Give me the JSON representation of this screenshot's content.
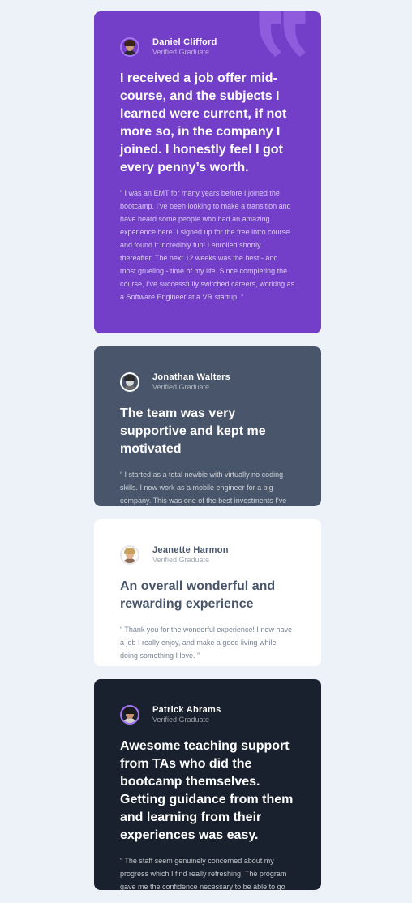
{
  "testimonials": [
    {
      "name": "Daniel Clifford",
      "role": "Verified Graduate",
      "headline": "I received a job offer mid-course, and the subjects I learned were current, if not more so, in the company I joined. I honestly feel I got every penny’s worth.",
      "body": "“ I was an EMT for many years before I joined the bootcamp. I’ve been looking to make a transition and have heard some people who had an amazing experience here. I signed up for the free intro course and found it incredibly fun! I enrolled shortly thereafter. The next 12 weeks was the best - and most grueling - time of my life. Since completing the course, I’ve successfully switched careers, working as a Software Engineer at a VR startup. ”",
      "color": "#733fc8"
    },
    {
      "name": "Jonathan Walters",
      "role": "Verified Graduate",
      "headline": "The team was very supportive and kept me motivated",
      "body": "“ I started as a total newbie with virtually no coding skills. I now work as a mobile engineer for a big company. This was one of the best investments I’ve made in myself. ”",
      "color": "#48556a"
    },
    {
      "name": "Jeanette Harmon",
      "role": "Verified Graduate",
      "headline": "An overall wonderful and rewarding experience",
      "body": "“ Thank you for the wonderful experience! I now have a job I really enjoy, and make a good living while doing something I love. ”",
      "color": "#ffffff"
    },
    {
      "name": "Patrick Abrams",
      "role": "Verified Graduate",
      "headline": "Awesome teaching support from TAs who did the bootcamp themselves. Getting guidance from them and learning from their experiences was easy.",
      "body": "“ The staff seem genuinely concerned about my progress which I find really refreshing. The program gave me the confidence necessary to be able to go out in the world and present myself as a capable junior developer. The standard is definitely high, but the experience was worth every penny. ”",
      "color": "#19212e"
    }
  ],
  "icons": {
    "quote": "quote-icon"
  }
}
